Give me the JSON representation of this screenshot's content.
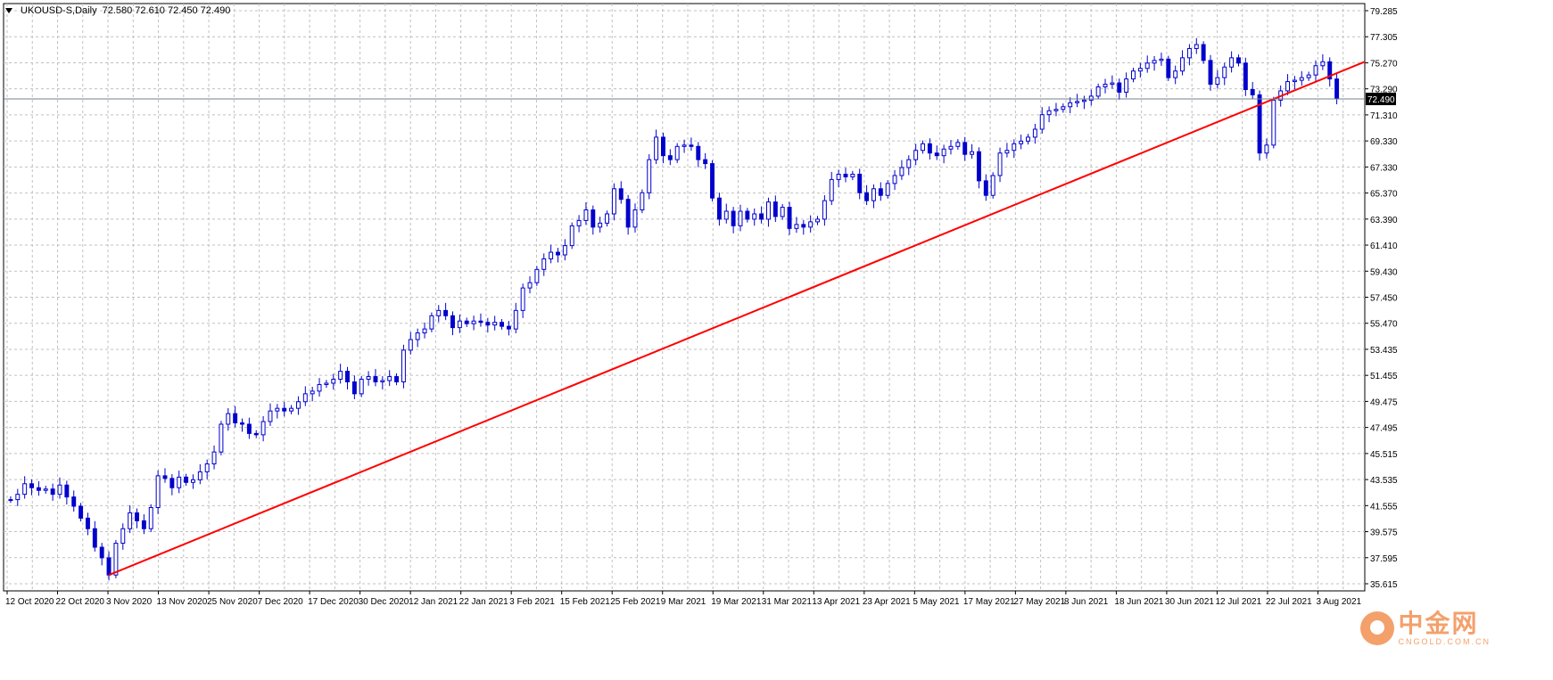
{
  "header": {
    "symbol": "UKOUSD-S,Daily",
    "ohlc": "72.580 72.610 72.450 72.490"
  },
  "last_price_label": "72.490",
  "logo": {
    "name": "中金网",
    "domain": "CNGOLD.COM.CN"
  },
  "colors": {
    "candle": "#0000cc",
    "trendline": "#ff0000",
    "grid": "#c0c0c0",
    "price_line": "#708090"
  },
  "chart_data": {
    "type": "candlestick",
    "title": "",
    "y_ticks": [
      "79.285",
      "77.305",
      "75.270",
      "73.290",
      "71.310",
      "69.330",
      "67.330",
      "65.370",
      "63.390",
      "61.410",
      "59.430",
      "57.450",
      "55.470",
      "53.435",
      "51.455",
      "49.475",
      "47.495",
      "45.515",
      "43.535",
      "41.555",
      "39.575",
      "37.595",
      "35.615"
    ],
    "x_ticks": [
      "12 Oct 2020",
      "22 Oct 2020",
      "3 Nov 2020",
      "13 Nov 2020",
      "25 Nov 2020",
      "7 Dec 2020",
      "17 Dec 2020",
      "30 Dec 2020",
      "12 Jan 2021",
      "22 Jan 2021",
      "3 Feb 2021",
      "15 Feb 2021",
      "25 Feb 2021",
      "9 Mar 2021",
      "19 Mar 2021",
      "31 Mar 2021",
      "13 Apr 2021",
      "23 Apr 2021",
      "5 May 2021",
      "17 May 2021",
      "27 May 2021",
      "8 Jun 2021",
      "18 Jun 2021",
      "30 Jun 2021",
      "12 Jul 2021",
      "22 Jul 2021",
      "3 Aug 2021"
    ],
    "ylim": [
      35.3,
      79.7
    ],
    "last_price": 72.49,
    "trendline": {
      "from": {
        "date": "2 Nov 2020",
        "value": 36.5
      },
      "to": {
        "date": "6 Aug 2021",
        "value": 75.3
      }
    },
    "closes": [
      42.2,
      42.6,
      43.4,
      43.1,
      42.9,
      43.0,
      42.6,
      43.3,
      42.4,
      41.7,
      40.8,
      40.0,
      38.6,
      37.8,
      36.5,
      38.9,
      40.0,
      41.2,
      40.6,
      40.0,
      41.6,
      44.0,
      43.8,
      43.1,
      43.9,
      43.5,
      43.7,
      44.3,
      44.9,
      45.8,
      47.9,
      48.7,
      48.0,
      47.9,
      47.2,
      47.1,
      48.1,
      48.9,
      49.1,
      48.9,
      49.1,
      49.6,
      50.2,
      50.4,
      50.9,
      51.0,
      51.3,
      51.9,
      51.1,
      50.2,
      51.3,
      51.5,
      51.1,
      51.2,
      51.5,
      51.1,
      53.5,
      54.3,
      54.8,
      55.1,
      56.1,
      56.5,
      56.1,
      55.2,
      55.7,
      55.5,
      55.7,
      55.6,
      55.4,
      55.6,
      55.3,
      55.1,
      56.5,
      58.2,
      58.6,
      59.6,
      60.4,
      60.9,
      60.7,
      61.4,
      62.9,
      63.3,
      64.1,
      62.8,
      63.1,
      63.8,
      65.7,
      64.9,
      62.8,
      64.1,
      65.4,
      67.9,
      69.6,
      68.2,
      67.9,
      68.9,
      69.0,
      68.9,
      67.9,
      67.6,
      65.0,
      63.4,
      64.0,
      62.9,
      64.0,
      63.4,
      63.8,
      63.4,
      64.7,
      63.6,
      64.3,
      62.7,
      63.0,
      62.8,
      63.2,
      63.4,
      64.8,
      66.4,
      66.8,
      66.6,
      66.8,
      65.4,
      64.8,
      65.7,
      65.2,
      66.1,
      66.7,
      67.3,
      67.9,
      68.6,
      69.1,
      68.4,
      68.2,
      68.7,
      68.9,
      69.2,
      68.3,
      68.5,
      66.3,
      65.2,
      66.7,
      68.4,
      68.6,
      69.1,
      69.3,
      69.6,
      70.2,
      71.3,
      71.6,
      71.7,
      71.9,
      72.2,
      72.3,
      72.4,
      72.7,
      73.4,
      73.6,
      73.7,
      73.0,
      74.0,
      74.6,
      74.8,
      75.2,
      75.4,
      75.5,
      74.1,
      74.6,
      75.6,
      76.3,
      76.6,
      75.4,
      73.6,
      74.1,
      74.9,
      75.6,
      75.2,
      73.2,
      72.8,
      68.4,
      69.0,
      72.4,
      73.1,
      73.8,
      73.9,
      74.1,
      74.3,
      75.0,
      75.3,
      74.0,
      72.5
    ],
    "max_points": 300
  }
}
